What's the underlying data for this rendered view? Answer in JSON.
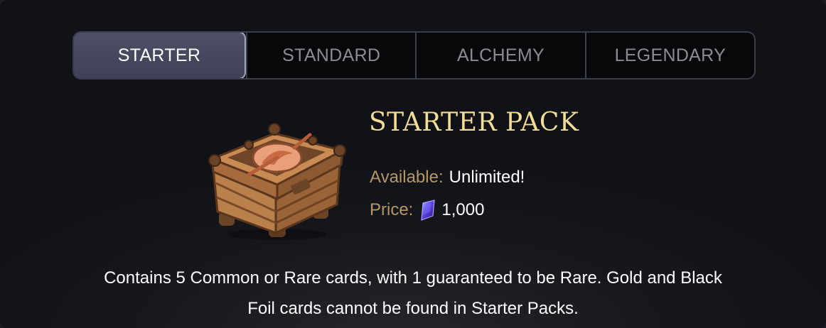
{
  "tabs": [
    {
      "label": "STARTER",
      "active": true
    },
    {
      "label": "STANDARD",
      "active": false
    },
    {
      "label": "ALCHEMY",
      "active": false
    },
    {
      "label": "LEGENDARY",
      "active": false
    }
  ],
  "pack": {
    "title": "STARTER PACK",
    "available_label": "Available:",
    "available_value": "Unlimited!",
    "price_label": "Price:",
    "price_value": "1,000",
    "price_icon": "gem-icon",
    "image": "wooden-chest-illustration",
    "description_line1": "Contains 5 Common or Rare cards, with 1 guaranteed to be Rare. Gold and Black",
    "description_line2": "Foil cards cannot be found in Starter Packs."
  },
  "colors": {
    "title": "#f2dd97",
    "label": "#b49764",
    "tab_active_bg": "#464a5f",
    "tab_inactive_text": "#8a8c95",
    "background": "#16171d"
  }
}
